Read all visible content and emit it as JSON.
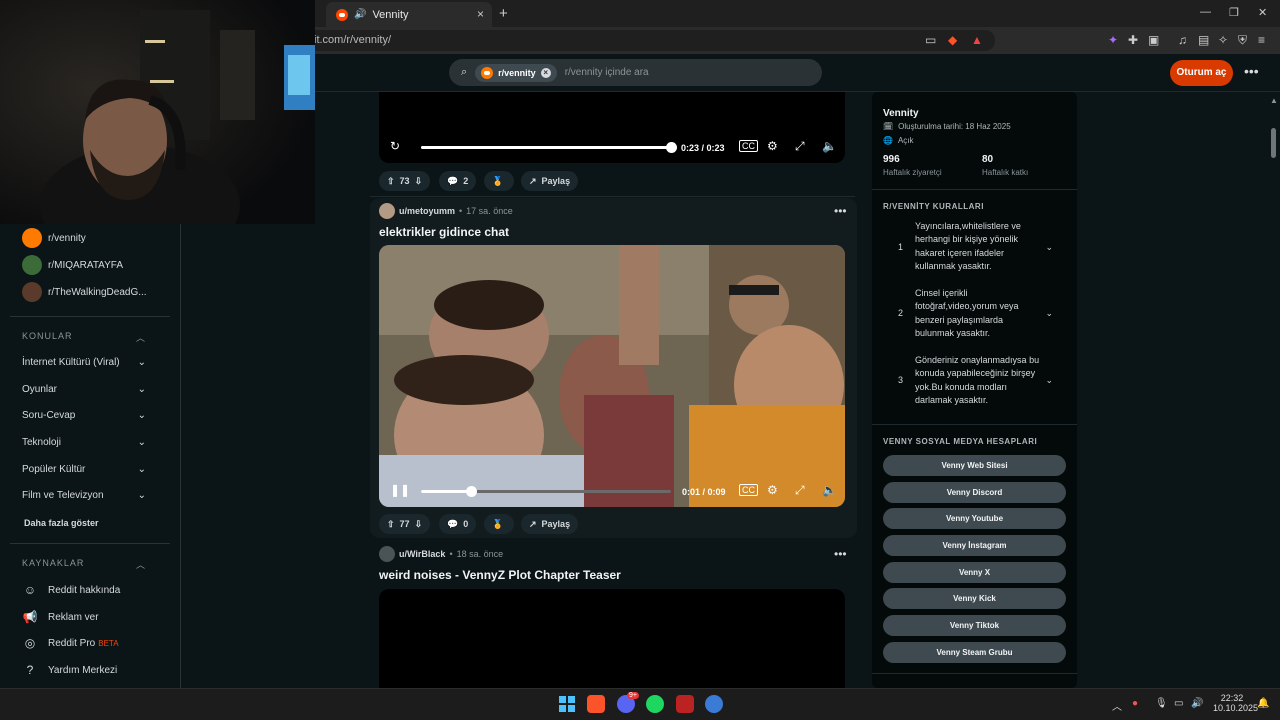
{
  "browser": {
    "tab_title": "Vennity",
    "tab_close": "×",
    "new_tab": "+",
    "url": "it.com/r/vennity/",
    "window_controls": [
      "—",
      "❐",
      "✕"
    ]
  },
  "header": {
    "community_chip": "r/vennity",
    "search_placeholder": "r/vennity içinde ara",
    "login_label": "Oturum aç",
    "more_label": "•••"
  },
  "sidebar": {
    "communities": [
      {
        "name": "r/vennity",
        "color": "#ff7a00"
      },
      {
        "name": "r/MIQARATAYFA",
        "color": "#3a6b38"
      },
      {
        "name": "r/TheWalkingDeadG...",
        "color": "#5a3a2a"
      }
    ],
    "topics_heading": "KONULAR",
    "topics": [
      "İnternet Kültürü (Viral)",
      "Oyunlar",
      "Soru-Cevap",
      "Teknoloji",
      "Popüler Kültür",
      "Film ve Televizyon"
    ],
    "show_more": "Daha fazla göster",
    "resources_heading": "KAYNAKLAR",
    "resources": [
      {
        "label": "Reddit hakkında",
        "icon": "reddit-alien-icon"
      },
      {
        "label": "Reklam ver",
        "icon": "megaphone-icon"
      },
      {
        "label": "Reddit Pro",
        "icon": "pro-icon",
        "badge": "BETA"
      },
      {
        "label": "Yardım Merkezi",
        "icon": "help-icon"
      }
    ]
  },
  "posts": [
    {
      "time": "0:23 / 0:23",
      "progress": 1.0,
      "upvotes": "73",
      "comments": "2",
      "share": "Paylaş"
    },
    {
      "user": "u/metoyumm",
      "age": "17 sa. önce",
      "title": "elektrikler gidince chat",
      "time": "0:01 / 0:09",
      "progress": 0.2,
      "upvotes": "77",
      "comments": "0",
      "share": "Paylaş"
    },
    {
      "user": "u/WirBlack",
      "age": "18 sa. önce",
      "title": "weird noises - VennyZ Plot Chapter Teaser"
    }
  ],
  "about": {
    "name": "Vennity",
    "created": "Oluşturulma tarihi: 18 Haz 2025",
    "visibility": "Açık",
    "visitors_value": "996",
    "visitors_label": "Haftalık ziyaretçi",
    "contrib_value": "80",
    "contrib_label": "Haftalık katkı"
  },
  "rules": {
    "heading": "R/VENNİTY KURALLARI",
    "items": [
      {
        "num": "1",
        "text": "Yayıncılara,whitelistlere ve herhangi bir kişiye yönelik hakaret içeren ifadeler kullanmak yasaktır."
      },
      {
        "num": "2",
        "text": "Cinsel içerikli fotoğraf,video,yorum veya benzeri paylaşımlarda bulunmak yasaktır."
      },
      {
        "num": "3",
        "text": "Gönderiniz onaylanmadıysa bu konuda yapabileceğiniz birşey yok.Bu konuda modları darlamak yasaktır."
      }
    ]
  },
  "social": {
    "heading": "VENNY SOSYAL MEDYA HESAPLARI",
    "buttons": [
      "Venny Web Sitesi",
      "Venny Discord",
      "Venny Youtube",
      "Venny İnstagram",
      "Venny X",
      "Venny Kick",
      "Venny Tiktok",
      "Venny Steam Grubu"
    ]
  },
  "taskbar": {
    "time": "22:32",
    "date": "10.10.2025",
    "discord_badge": "9+"
  }
}
